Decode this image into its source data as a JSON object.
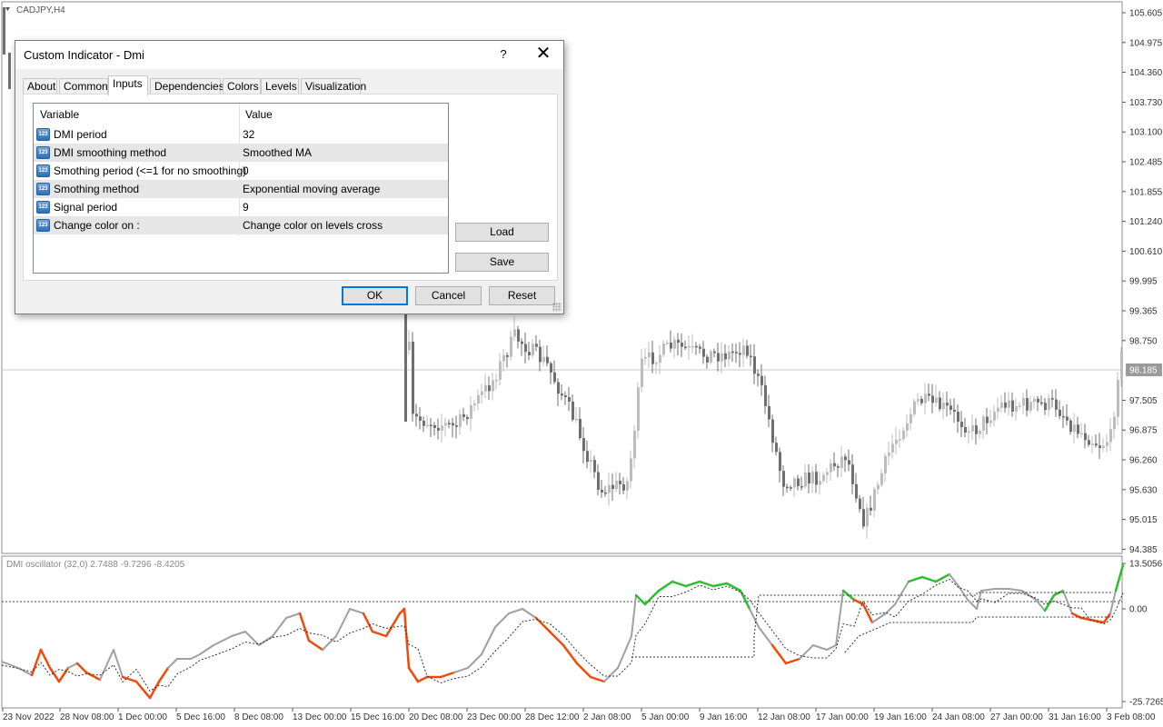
{
  "main_chart": {
    "symbol_label": "CADJPY,H4",
    "price_ticks": [
      "105.605",
      "104.975",
      "104.360",
      "103.730",
      "103.100",
      "102.485",
      "101.855",
      "101.240",
      "100.610",
      "99.995",
      "99.365",
      "98.750",
      "97.505",
      "96.875",
      "96.260",
      "95.630",
      "95.015",
      "94.385"
    ],
    "current_price": "98.185"
  },
  "indicator_window": {
    "label": "DMI oscillator (32,0) 2.7488 -9.7296 -8.4205",
    "ticks": [
      "13.5056",
      "0.00",
      "-25.7265"
    ],
    "colors": {
      "up": "#2ebd2e",
      "down": "#f04a0a",
      "neutral": "#a0a0a0"
    }
  },
  "time_axis": [
    "23 Nov 2022",
    "28 Nov 08:00",
    "1 Dec 00:00",
    "5 Dec 16:00",
    "8 Dec 08:00",
    "13 Dec 00:00",
    "15 Dec 16:00",
    "20 Dec 08:00",
    "23 Dec 00:00",
    "28 Dec 12:00",
    "2 Jan 08:00",
    "5 Jan 00:00",
    "9 Jan 16:00",
    "12 Jan 08:00",
    "17 Jan 00:00",
    "19 Jan 16:00",
    "24 Jan 08:00",
    "27 Jan 00:00",
    "31 Jan 16:00",
    "3 Feb 08:00"
  ],
  "dialog": {
    "title": "Custom Indicator - Dmi",
    "help": "?",
    "close": "✕",
    "tabs": [
      "About",
      "Common",
      "Inputs",
      "Dependencies",
      "Colors",
      "Levels",
      "Visualization"
    ],
    "active_tab": "Inputs",
    "grid_headers": {
      "variable": "Variable",
      "value": "Value"
    },
    "params": [
      {
        "variable": "DMI period",
        "value": "32"
      },
      {
        "variable": "DMI smoothing method",
        "value": "Smoothed MA"
      },
      {
        "variable": "Smothing period (<=1 for no smoothing)",
        "value": "0"
      },
      {
        "variable": "Smothing method",
        "value": "Exponential moving average"
      },
      {
        "variable": "Signal period",
        "value": "9"
      },
      {
        "variable": "Change color on :",
        "value": "Change color on levels cross"
      }
    ],
    "buttons": {
      "load": "Load",
      "save": "Save",
      "ok": "OK",
      "cancel": "Cancel",
      "reset": "Reset"
    }
  }
}
